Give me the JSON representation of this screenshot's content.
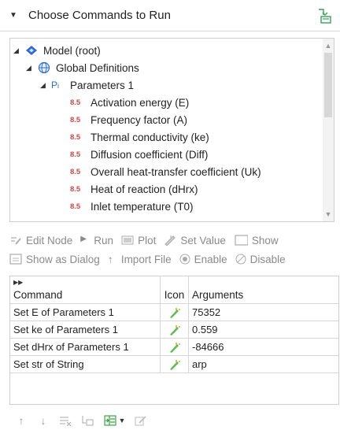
{
  "header": {
    "title": "Choose Commands to Run"
  },
  "tree": {
    "root": "Model (root)",
    "global": "Global Definitions",
    "params_group": "Parameters 1",
    "params": [
      "Activation energy (E)",
      "Frequency factor (A)",
      "Thermal conductivity (ke)",
      "Diffusion coefficient (Diff)",
      "Overall heat-transfer coefficient (Uk)",
      "Heat of reaction (dHrx)",
      "Inlet temperature (T0)"
    ]
  },
  "toolbar": {
    "edit_node": "Edit Node",
    "run": "Run",
    "plot": "Plot",
    "set_value": "Set Value",
    "show": "Show",
    "show_as_dialog": "Show as Dialog",
    "import_file": "Import File",
    "enable": "Enable",
    "disable": "Disable"
  },
  "table": {
    "headers": [
      "Command",
      "Icon",
      "Arguments"
    ],
    "rows": [
      {
        "command": "Set E of Parameters 1",
        "arguments": "75352"
      },
      {
        "command": "Set ke of Parameters 1",
        "arguments": "0.559"
      },
      {
        "command": "Set dHrx of Parameters 1",
        "arguments": "-84666"
      },
      {
        "command": "Set str of String",
        "arguments": "arp"
      }
    ]
  },
  "colors": {
    "accent": "#2a6ad6",
    "icon_green": "#4caf50",
    "param_red": "#d04848"
  }
}
